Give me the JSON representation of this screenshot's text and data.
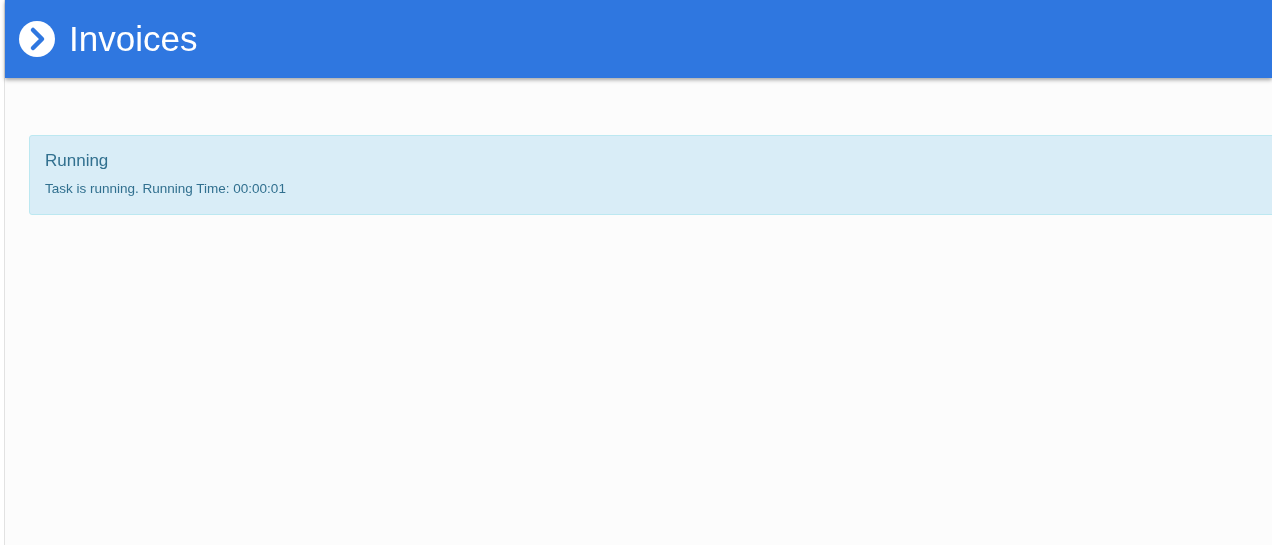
{
  "header": {
    "title": "Invoices"
  },
  "alert": {
    "kind": "info",
    "title": "Running",
    "message": "Task is running. Running Time: 00:00:01"
  }
}
